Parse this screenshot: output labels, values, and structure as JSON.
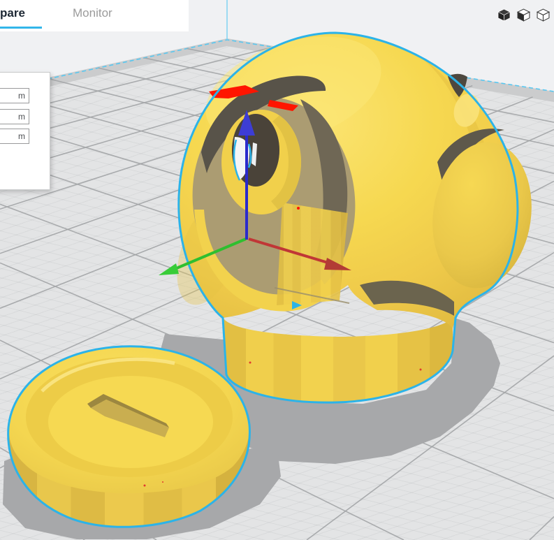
{
  "header": {
    "tabs": [
      {
        "label": "pare",
        "active": true
      },
      {
        "label": "Monitor",
        "active": false
      }
    ],
    "view_icons": [
      {
        "name": "solid-view-icon"
      },
      {
        "name": "xray-view-icon"
      },
      {
        "name": "layer-view-icon"
      }
    ]
  },
  "tool_panel": {
    "fields": [
      {
        "value": "m"
      },
      {
        "value": "m"
      },
      {
        "value": "m"
      }
    ]
  },
  "scene": {
    "selected_models": [
      "ball-with-holes",
      "cap-disc"
    ],
    "gizmo": {
      "axes": [
        "x-red",
        "y-green",
        "z-blue"
      ]
    },
    "colors": {
      "model_yellow": "#f5d84f",
      "model_shadow_tan": "#d9b83e",
      "selection_outline": "#2cb3e8",
      "overhang_red": "#ff1500",
      "axis_x_red": "#c03636",
      "axis_y_green": "#35c435",
      "axis_z_blue": "#3434d0",
      "plate": "#e3e4e5",
      "grid_major": "#a2a4a6",
      "plate_edge_dash": "#58c7f0",
      "drop_shadow": "#a7a8aa",
      "background": "#f0f1f3",
      "tab_accent": "#33b6ea"
    }
  }
}
